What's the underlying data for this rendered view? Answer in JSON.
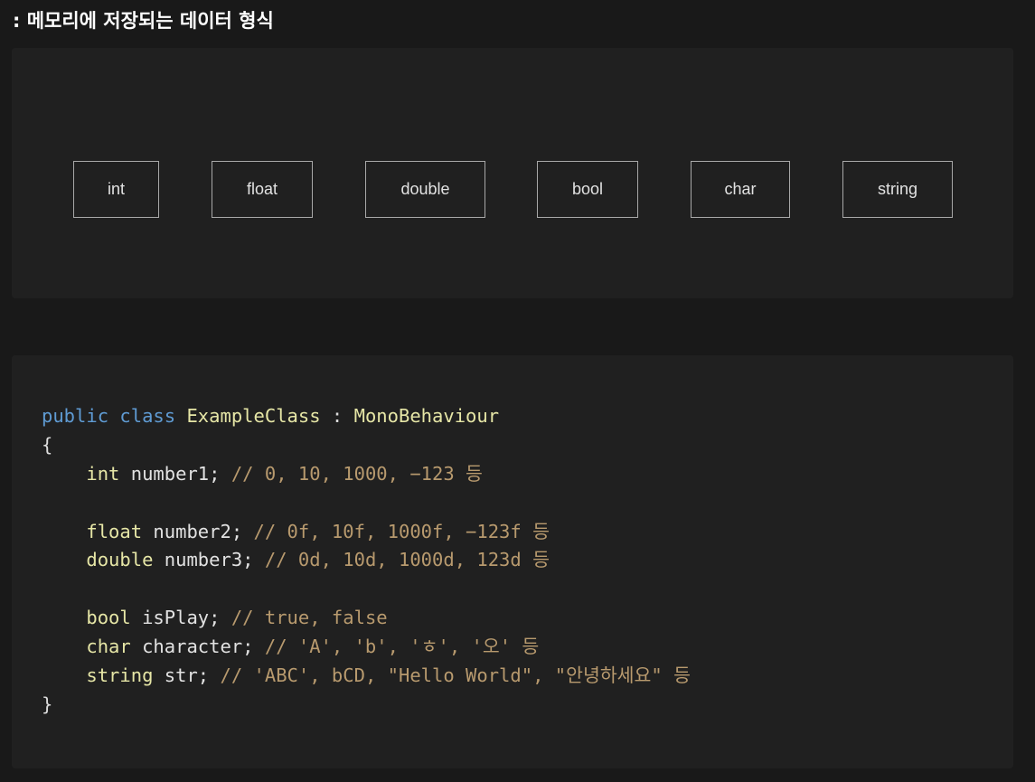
{
  "heading": ": 메모리에 저장되는 데이터 형식",
  "types": [
    "int",
    "float",
    "double",
    "bool",
    "char",
    "string"
  ],
  "code": {
    "line1": {
      "kw_public": "public",
      "kw_class": "class",
      "class_name": "ExampleClass",
      "colon": " : ",
      "base": "MonoBehaviour"
    },
    "open_brace": "{",
    "close_brace": "}",
    "fields": [
      {
        "type": "int",
        "name": " number1;",
        "comment": " // 0, 10, 1000, −123 등"
      },
      {
        "type": "float",
        "name": " number2;",
        "comment": " // 0f, 10f, 1000f, −123f 등"
      },
      {
        "type": "double",
        "name": " number3;",
        "comment": " // 0d, 10d, 1000d, 123d 등"
      },
      {
        "type": "bool",
        "name": " isPlay;",
        "comment": " // true, false"
      },
      {
        "type": "char",
        "name": " character;",
        "comment": " // 'A', 'b', 'ㅎ', '오' 등"
      },
      {
        "type": "string",
        "name": " str;",
        "comment": " // 'ABC', bCD, \"Hello World\", \"안녕하세요\" 등"
      }
    ]
  },
  "colors": {
    "background": "#191919",
    "panel": "#202020",
    "keyword": "#5f9bd3",
    "type": "#e6e6a6",
    "comment": "#b89a6e",
    "box_border": "#a8a8a8"
  }
}
